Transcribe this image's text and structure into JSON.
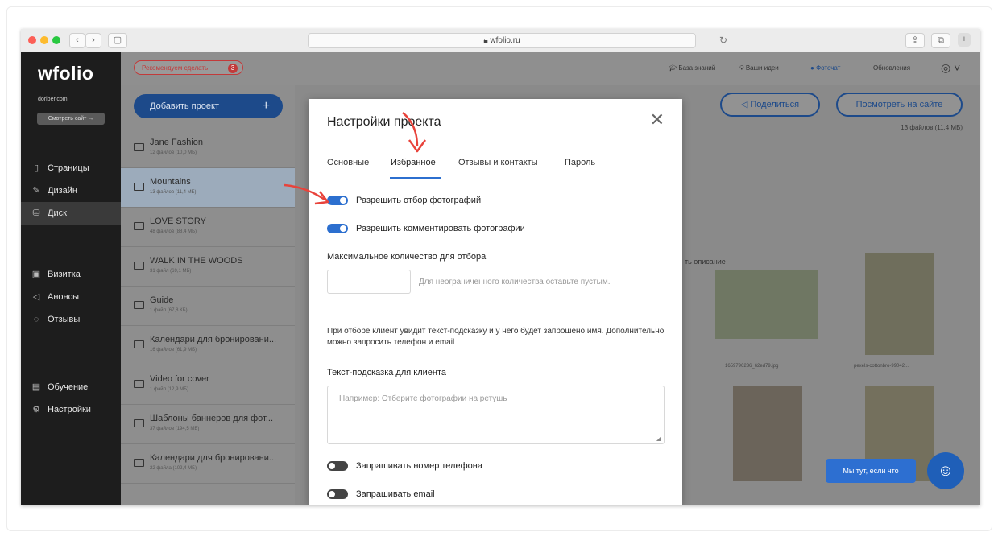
{
  "browser": {
    "url": "wfolio.ru"
  },
  "sidebar": {
    "logo": "wfolio",
    "site": "dorlber.com",
    "view_site": "Смотреть сайт →",
    "items": [
      {
        "label": "Страницы",
        "icon": "page-icon"
      },
      {
        "label": "Дизайн",
        "icon": "brush-icon"
      },
      {
        "label": "Диск",
        "icon": "disk-icon"
      },
      {
        "label": "Визитка",
        "icon": "card-icon"
      },
      {
        "label": "Анонсы",
        "icon": "megaphone-icon"
      },
      {
        "label": "Отзывы",
        "icon": "chat-icon"
      },
      {
        "label": "Обучение",
        "icon": "book-icon"
      },
      {
        "label": "Настройки",
        "icon": "gear-icon"
      }
    ]
  },
  "topbar": {
    "recommend": "Рекомендуем сделать",
    "recommend_count": "3",
    "links": [
      "База знаний",
      "Ваши идеи",
      "Фоточат",
      "Обновления"
    ]
  },
  "projects": {
    "add": "Добавить проект",
    "items": [
      {
        "name": "Jane Fashion",
        "sub": "12 файлов (10,0 МБ)"
      },
      {
        "name": "Mountains",
        "sub": "13 файлов (11,4 МБ)"
      },
      {
        "name": "LOVE STORY",
        "sub": "48 файлов (88,4 МБ)"
      },
      {
        "name": "WALK IN THE WOODS",
        "sub": "31 файл (69,1 МБ)"
      },
      {
        "name": "Guide",
        "sub": "1 файл (67,8 КБ)"
      },
      {
        "name": "Календари для бронировани...",
        "sub": "16 файлов (61,9 МБ)"
      },
      {
        "name": "Video for cover",
        "sub": "1 файл (12,9 МБ)"
      },
      {
        "name": "Шаблоны баннеров для фот...",
        "sub": "37 файлов (194,5 МБ)"
      },
      {
        "name": "Календари для бронировани...",
        "sub": "22 файла (102,4 МБ)"
      }
    ]
  },
  "main": {
    "share": "Поделиться",
    "view_on_site": "Посмотреть на сайте",
    "files": "13 файлов (11,4 МБ)",
    "desc": "ть описание",
    "captions": [
      "1659796236_62ed79.jpg",
      "pexels-cottonbro-99042..."
    ],
    "chat_label": "Мы тут, если что"
  },
  "modal": {
    "title": "Настройки проекта",
    "tabs": [
      "Основные",
      "Избранное",
      "Отзывы и контакты",
      "Пароль"
    ],
    "allow_select": "Разрешить отбор фотографий",
    "allow_comment": "Разрешить комментировать фотографии",
    "max_label": "Максимальное количество для отбора",
    "max_hint": "Для неограниченного количества оставьте пустым.",
    "info": "При отборе клиент увидит текст-подсказку и у него будет запрошено имя. Дополнительно можно запросить телефон и email",
    "hint_label": "Текст-подсказка для клиента",
    "hint_placeholder": "Например: Отберите фотографии на ретушь",
    "ask_phone": "Запрашивать номер телефона",
    "ask_email": "Запрашивать email"
  },
  "colors": {
    "accent": "#2c6fcf",
    "brand_dark": "#1d4a8a",
    "annotation": "#e8433b"
  }
}
